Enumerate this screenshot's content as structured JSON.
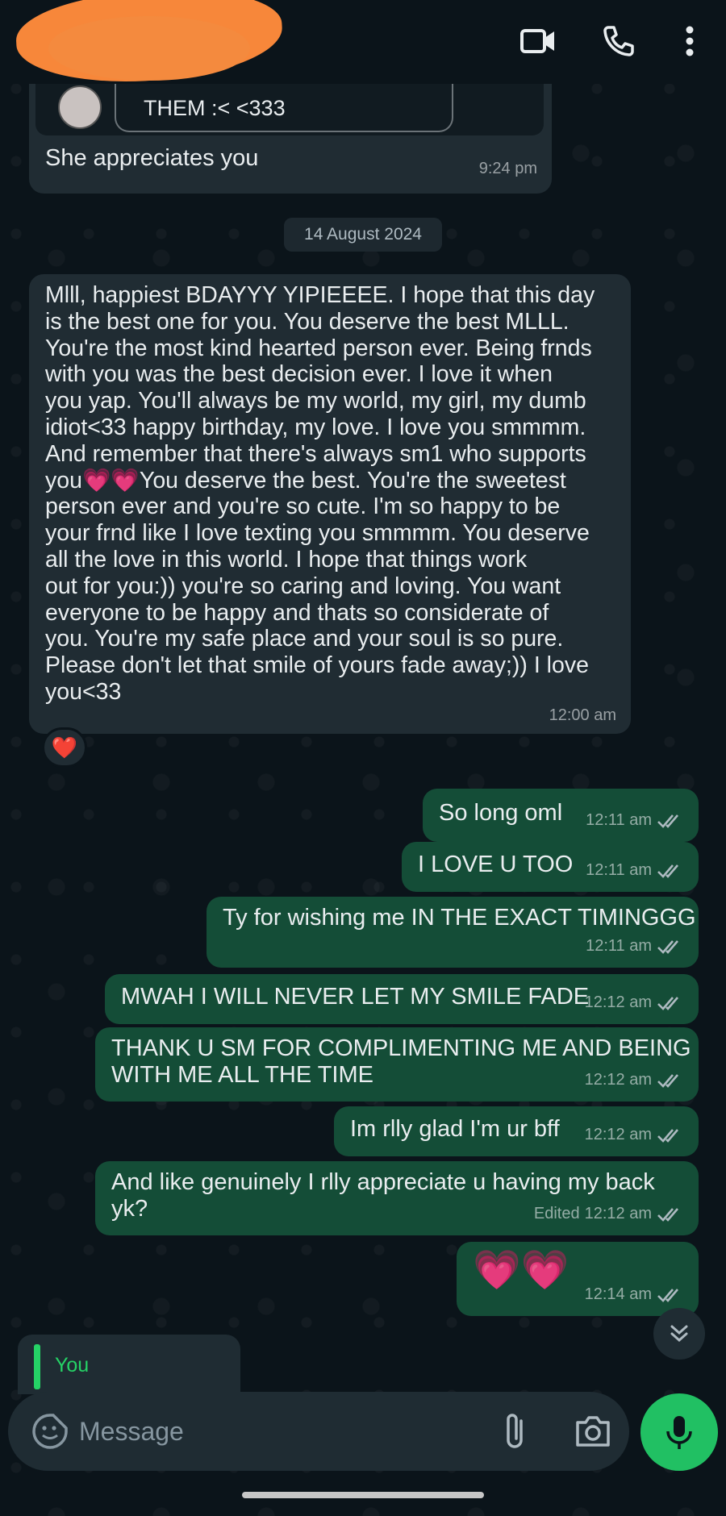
{
  "header": {
    "back_label": "<",
    "icons": [
      "video-call-icon",
      "phone-icon",
      "more-icon"
    ]
  },
  "quoted": {
    "them_text": "THEM :< <333",
    "message": "She appreciates you",
    "time": "9:24 pm"
  },
  "date_chip": "14 August 2024",
  "long_message": {
    "lines": [
      "Mlll, happiest BDAYYY YIPIEEEE. I hope that this day",
      "is the best one for you. You deserve the best MLLL.",
      "You're the most kind hearted person ever. Being frnds",
      "with you was the best decision ever. I love it when",
      "you yap. You'll always be my world, my girl, my dumb",
      "idiot<33 happy birthday, my love. I love you smmmm.",
      "And remember that there's always sm1 who supports",
      "you💗💗You deserve the best. You're the sweetest",
      "person ever and you're so cute. I'm so happy to be",
      "your frnd like I love texting you smmmm. You deserve",
      "all the love in this world. I hope that things work",
      "out for you:)) you're so caring and loving. You want",
      "everyone to be happy and thats so considerate of",
      "you. You're my safe place and your soul is so pure.",
      "Please don't let that smile of yours fade away;)) I love",
      "you<33"
    ],
    "time": "12:00 am",
    "reaction": "❤️"
  },
  "outgoing": [
    {
      "text": "So long oml",
      "time": "12:11 am"
    },
    {
      "text": "I LOVE U TOO",
      "time": "12:11 am"
    },
    {
      "text": "Ty for wishing me IN THE EXACT TIMINGGG",
      "time": "12:11 am"
    },
    {
      "text": "MWAH I WILL NEVER LET MY SMILE FADE",
      "time": "12:12 am"
    },
    {
      "text": "THANK U SM FOR COMPLIMENTING ME AND BEING",
      "text2": "WITH ME ALL THE TIME",
      "time": "12:12 am"
    },
    {
      "text": "Im rlly glad I'm ur bff",
      "time": "12:12 am"
    },
    {
      "text": "And like genuinely I rlly appreciate u having my back",
      "text2": "yk?",
      "time": "12:12 am",
      "edited": "Edited"
    },
    {
      "text": "💗💗",
      "time": "12:14 am"
    }
  ],
  "reply_preview": {
    "author": "You"
  },
  "composer": {
    "placeholder": "Message"
  },
  "colors": {
    "incoming": "#202c33",
    "outgoing": "#144d37",
    "accent": "#21c063",
    "background": "#0b141a"
  }
}
